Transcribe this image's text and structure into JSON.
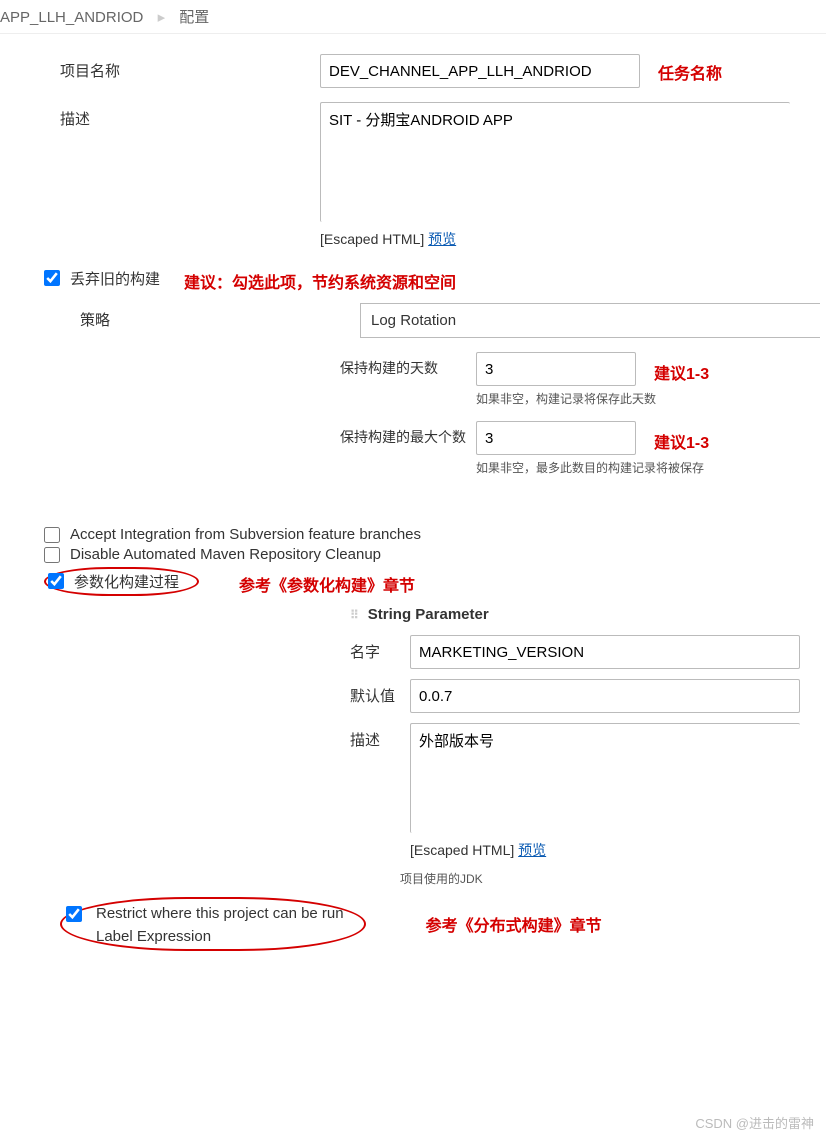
{
  "breadcrumb": {
    "item1": "APP_LLH_ANDRIOD",
    "item2": "配置"
  },
  "project": {
    "label": "项目名称",
    "value": "DEV_CHANNEL_APP_LLH_ANDRIOD",
    "annotation": "任务名称"
  },
  "description": {
    "label": "描述",
    "value": "SIT - 分期宝ANDROID APP",
    "escaped": "[Escaped HTML]",
    "preview": "预览"
  },
  "discard": {
    "label": "丢弃旧的构建",
    "annotation": "建议：勾选此项，节约系统资源和空间"
  },
  "strategy": {
    "label": "策略",
    "value": "Log Rotation"
  },
  "keep_days": {
    "label": "保持构建的天数",
    "value": "3",
    "annotation": "建议1-3",
    "hint": "如果非空，构建记录将保存此天数"
  },
  "keep_max": {
    "label": "保持构建的最大个数",
    "value": "3",
    "annotation": "建议1-3",
    "hint": "如果非空，最多此数目的构建记录将被保存"
  },
  "checkboxes": {
    "accept_integration": "Accept Integration from Subversion feature branches",
    "disable_cleanup": "Disable Automated Maven Repository Cleanup",
    "parameterized": "参数化构建过程",
    "parameterized_annotation": "参考《参数化构建》章节"
  },
  "param": {
    "header": "String Parameter",
    "name_label": "名字",
    "name_value": "MARKETING_VERSION",
    "default_label": "默认值",
    "default_value": "0.0.7",
    "desc_label": "描述",
    "desc_value": "外部版本号",
    "escaped": "[Escaped HTML]",
    "preview": "预览"
  },
  "jdk_hint": "项目使用的JDK",
  "restrict": {
    "label": "Restrict where this project can be run",
    "label_expr": "Label Expression",
    "annotation": "参考《分布式构建》章节"
  },
  "watermark": "CSDN @进击的雷神"
}
